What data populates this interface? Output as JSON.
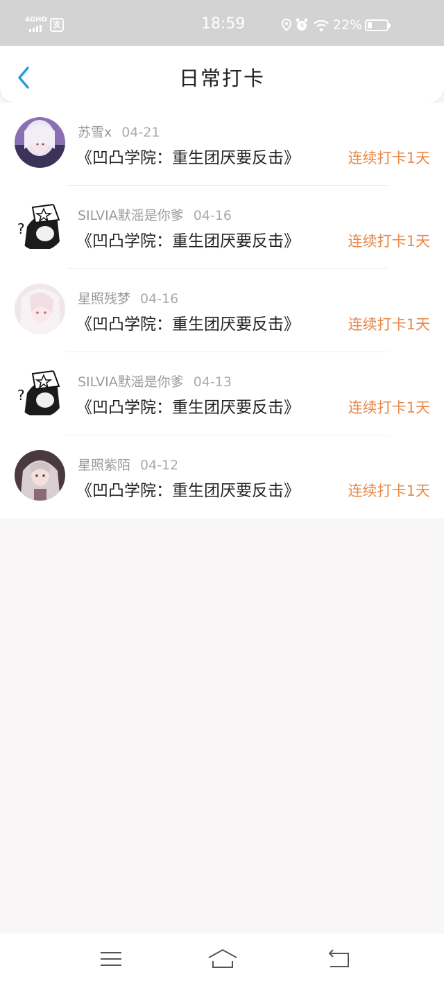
{
  "status_bar": {
    "network": "4GHD",
    "app_icon": "支",
    "time": "18:59",
    "battery_percent": "22%",
    "battery_level": 0.22,
    "icons": [
      "signal-icon",
      "location-icon",
      "alarm-icon",
      "wifi-icon",
      "battery-icon"
    ]
  },
  "header": {
    "title": "日常打卡",
    "back_icon": "chevron-left-icon",
    "accent_color": "#2a9bd9"
  },
  "checkins": [
    {
      "user": "苏雪x",
      "date": "04-21",
      "book": "《凹凸学院：重生团厌要反击》",
      "streak": "连续打卡1天",
      "avatar": "anime-avatar"
    },
    {
      "user": "SILVIA默滛是你爹",
      "date": "04-16",
      "book": "《凹凸学院：重生团厌要反击》",
      "streak": "连续打卡1天",
      "avatar": "bw-sketch-avatar"
    },
    {
      "user": "星照残梦",
      "date": "04-16",
      "book": "《凹凸学院：重生团厌要反击》",
      "streak": "连续打卡1天",
      "avatar": "anime-avatar"
    },
    {
      "user": "SILVIA默滛是你爹",
      "date": "04-13",
      "book": "《凹凸学院：重生团厌要反击》",
      "streak": "连续打卡1天",
      "avatar": "bw-sketch-avatar"
    },
    {
      "user": "星照紫陌",
      "date": "04-12",
      "book": "《凹凸学院：重生团厌要反击》",
      "streak": "连续打卡1天",
      "avatar": "doll-avatar"
    }
  ],
  "colors": {
    "streak": "#e8894a",
    "background": "#f8f6f6",
    "status_bar": "#d3d3d3"
  },
  "nav_bar": {
    "buttons": [
      "menu-icon",
      "home-icon",
      "back-icon"
    ]
  }
}
